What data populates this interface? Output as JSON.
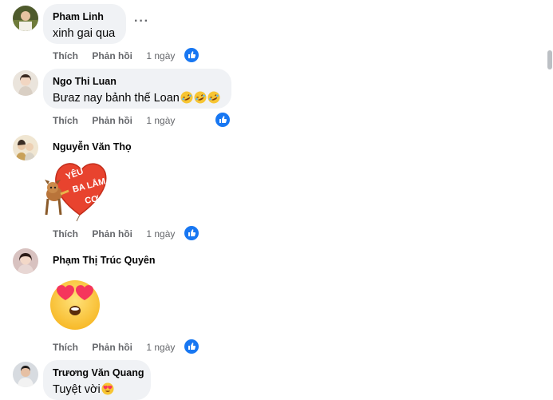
{
  "comments": [
    {
      "name": "Pham Linh",
      "text": "xinh gai qua",
      "actions": {
        "like": "Thích",
        "reply": "Phản hồi",
        "time": "1 ngày"
      },
      "reaction": "like"
    },
    {
      "name": "Ngo Thi Luan",
      "text": "Bưaz nay bảnh thế Loan",
      "emojis": [
        "rolling-laughing-emoji",
        "rolling-laughing-emoji",
        "rolling-laughing-emoji"
      ],
      "actions": {
        "like": "Thích",
        "reply": "Phản hồi",
        "time": "1 ngày"
      },
      "reaction": "like"
    },
    {
      "name": "Nguyễn Văn Thọ",
      "sticker": "heart-balloon-sticker",
      "sticker_text": "YÊU BA LẮM CƠ",
      "actions": {
        "like": "Thích",
        "reply": "Phản hồi",
        "time": "1 ngày"
      },
      "reaction": "like"
    },
    {
      "name": "Phạm Thị Trúc Quyên",
      "sticker": "heart-eyes-emoji-sticker",
      "actions": {
        "like": "Thích",
        "reply": "Phản hồi",
        "time": "1 ngày"
      },
      "reaction": "like"
    },
    {
      "name": "Trương Văn Quang",
      "text": "Tuyệt vời",
      "emojis": [
        "heart-eyes-emoji"
      ]
    }
  ],
  "more_menu_icon": "ellipsis-icon",
  "colors": {
    "bubble": "#f0f2f5",
    "secondary_text": "#65676b",
    "like_blue": "#1877f2"
  }
}
